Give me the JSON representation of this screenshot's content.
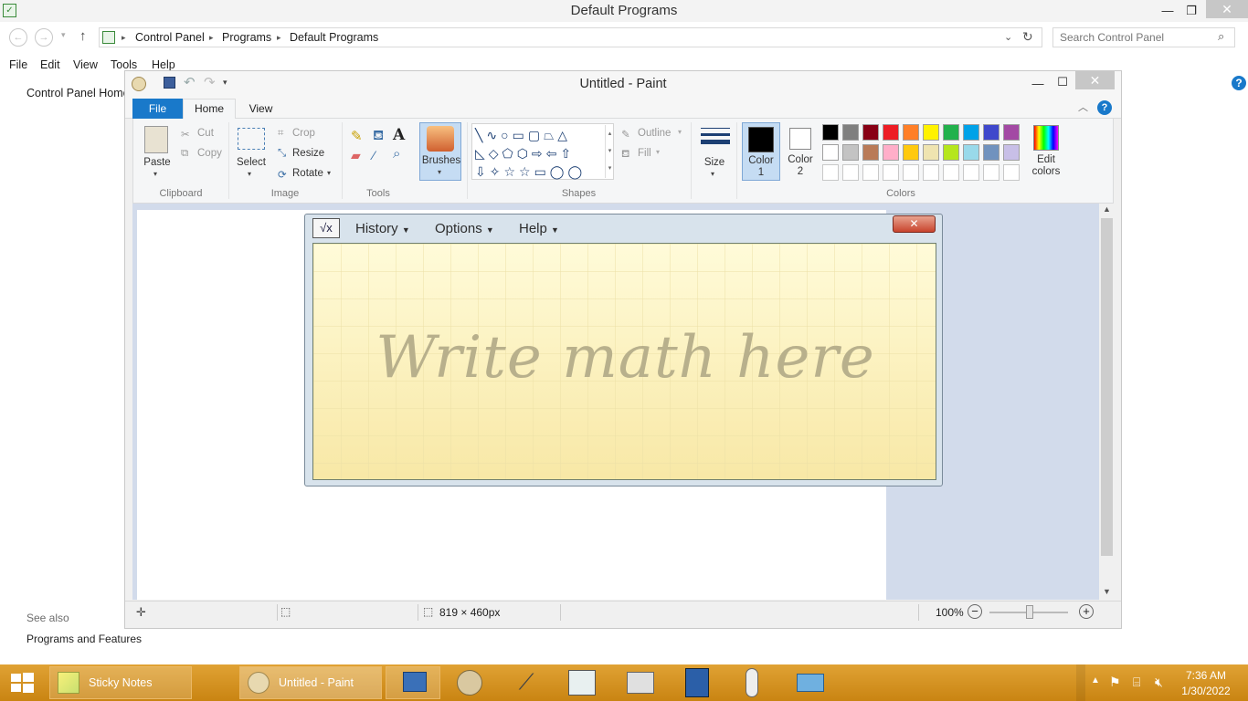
{
  "control_panel": {
    "title": "Default Programs",
    "breadcrumbs": [
      "Control Panel",
      "Programs",
      "Default Programs"
    ],
    "search_placeholder": "Search Control Panel",
    "menu": [
      "File",
      "Edit",
      "View",
      "Tools",
      "Help"
    ],
    "sidebar_home": "Control Panel Home",
    "see_also": "See also",
    "programs_and_features": "Programs and Features"
  },
  "paint": {
    "title": "Untitled - Paint",
    "tabs": {
      "file": "File",
      "home": "Home",
      "view": "View"
    },
    "clipboard": {
      "paste": "Paste",
      "cut": "Cut",
      "copy": "Copy",
      "label": "Clipboard"
    },
    "image": {
      "select": "Select",
      "crop": "Crop",
      "resize": "Resize",
      "rotate": "Rotate",
      "label": "Image"
    },
    "tools": {
      "label": "Tools"
    },
    "brushes": {
      "label": "Brushes"
    },
    "shapes": {
      "outline": "Outline",
      "fill": "Fill",
      "label": "Shapes"
    },
    "size": {
      "label": "Size"
    },
    "color1": {
      "line1": "Color",
      "line2": "1"
    },
    "color2": {
      "line1": "Color",
      "line2": "2"
    },
    "colors": {
      "label": "Colors",
      "edit_line1": "Edit",
      "edit_line2": "colors",
      "row1": [
        "#000000",
        "#7f7f7f",
        "#880015",
        "#ed1c24",
        "#ff7f27",
        "#fff200",
        "#22b14c",
        "#00a2e8",
        "#3f48cc",
        "#a349a4"
      ],
      "row2": [
        "#ffffff",
        "#c3c3c3",
        "#b97a57",
        "#ffaec9",
        "#ffc90e",
        "#efe4b0",
        "#b5e61d",
        "#99d9ea",
        "#7092be",
        "#c8bfe7"
      ],
      "row3": [
        "#ffffff",
        "#ffffff",
        "#ffffff",
        "#ffffff",
        "#ffffff",
        "#ffffff",
        "#ffffff",
        "#ffffff",
        "#ffffff",
        "#ffffff"
      ]
    },
    "status": {
      "dimensions": "819 × 460px",
      "zoom": "100%"
    }
  },
  "math_panel": {
    "menu": [
      "History",
      "Options",
      "Help"
    ],
    "placeholder": "Write math here"
  },
  "taskbar": {
    "items": [
      "Sticky Notes",
      "Untitled - Paint"
    ],
    "time": "7:36 AM",
    "date": "1/30/2022"
  }
}
